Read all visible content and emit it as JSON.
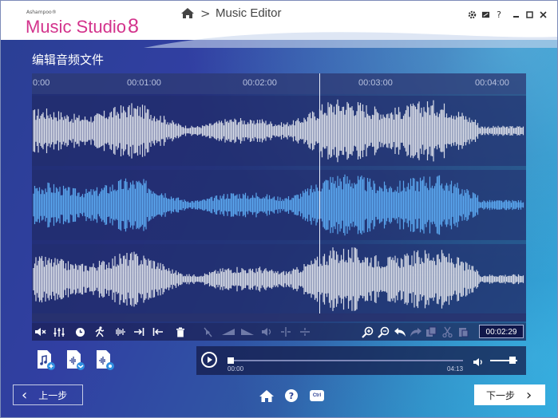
{
  "app": {
    "brand_small": "Ashampoo®",
    "brand_name": "Music Studio",
    "brand_version": "8"
  },
  "breadcrumb": {
    "separator": ">",
    "title": "Music Editor"
  },
  "window_controls": {
    "settings_icon": "gear-icon",
    "skin_icon": "palette-icon",
    "help": "?",
    "minimize_icon": "minimize-icon",
    "maximize_icon": "maximize-icon",
    "close_icon": "close-icon"
  },
  "page": {
    "title": "编辑音频文件"
  },
  "timeline": {
    "ticks": [
      "0:00",
      "00:01:00",
      "00:02:00",
      "00:03:00",
      "00:04:00"
    ],
    "playhead_fraction": 0.58
  },
  "tracks": [
    {
      "name": "left-channel",
      "color": "#d7dbe6"
    },
    {
      "name": "mixed-channel",
      "color": "#5aa6ee"
    },
    {
      "name": "right-channel",
      "color": "#d7dbe6"
    }
  ],
  "toolbar": {
    "position_time": "00:02:29",
    "tools": [
      "mute-icon",
      "equalizer-icon",
      "time-icon",
      "run-icon",
      "noise-icon",
      "cut-end-icon",
      "cut-start-icon",
      "delete-icon",
      "mute-dim-icon",
      "fade-in-icon",
      "fade-out-icon",
      "volume-dim-icon",
      "split-icon",
      "join-icon",
      "zoom-in-icon",
      "zoom-out-icon",
      "undo-icon",
      "redo-icon",
      "copy-icon",
      "cut-icon",
      "paste-icon"
    ]
  },
  "file_buttons": [
    "add-file-icon",
    "merge-file-icon",
    "export-file-icon"
  ],
  "player": {
    "current_time": "00:00",
    "total_time": "04:13",
    "progress_fraction": 0.0,
    "volume_fraction": 0.75
  },
  "footer": {
    "back_label": "上一步",
    "next_label": "下一步",
    "ctrl_label": "Ctrl",
    "help_label": "?",
    "home_icon": "home-icon"
  },
  "colors": {
    "brand_pink": "#d3338c",
    "background_start": "#2a3f93",
    "background_end": "#2ba5da",
    "waveform_light": "#d7dbe6",
    "waveform_blue": "#5aa6ee"
  }
}
